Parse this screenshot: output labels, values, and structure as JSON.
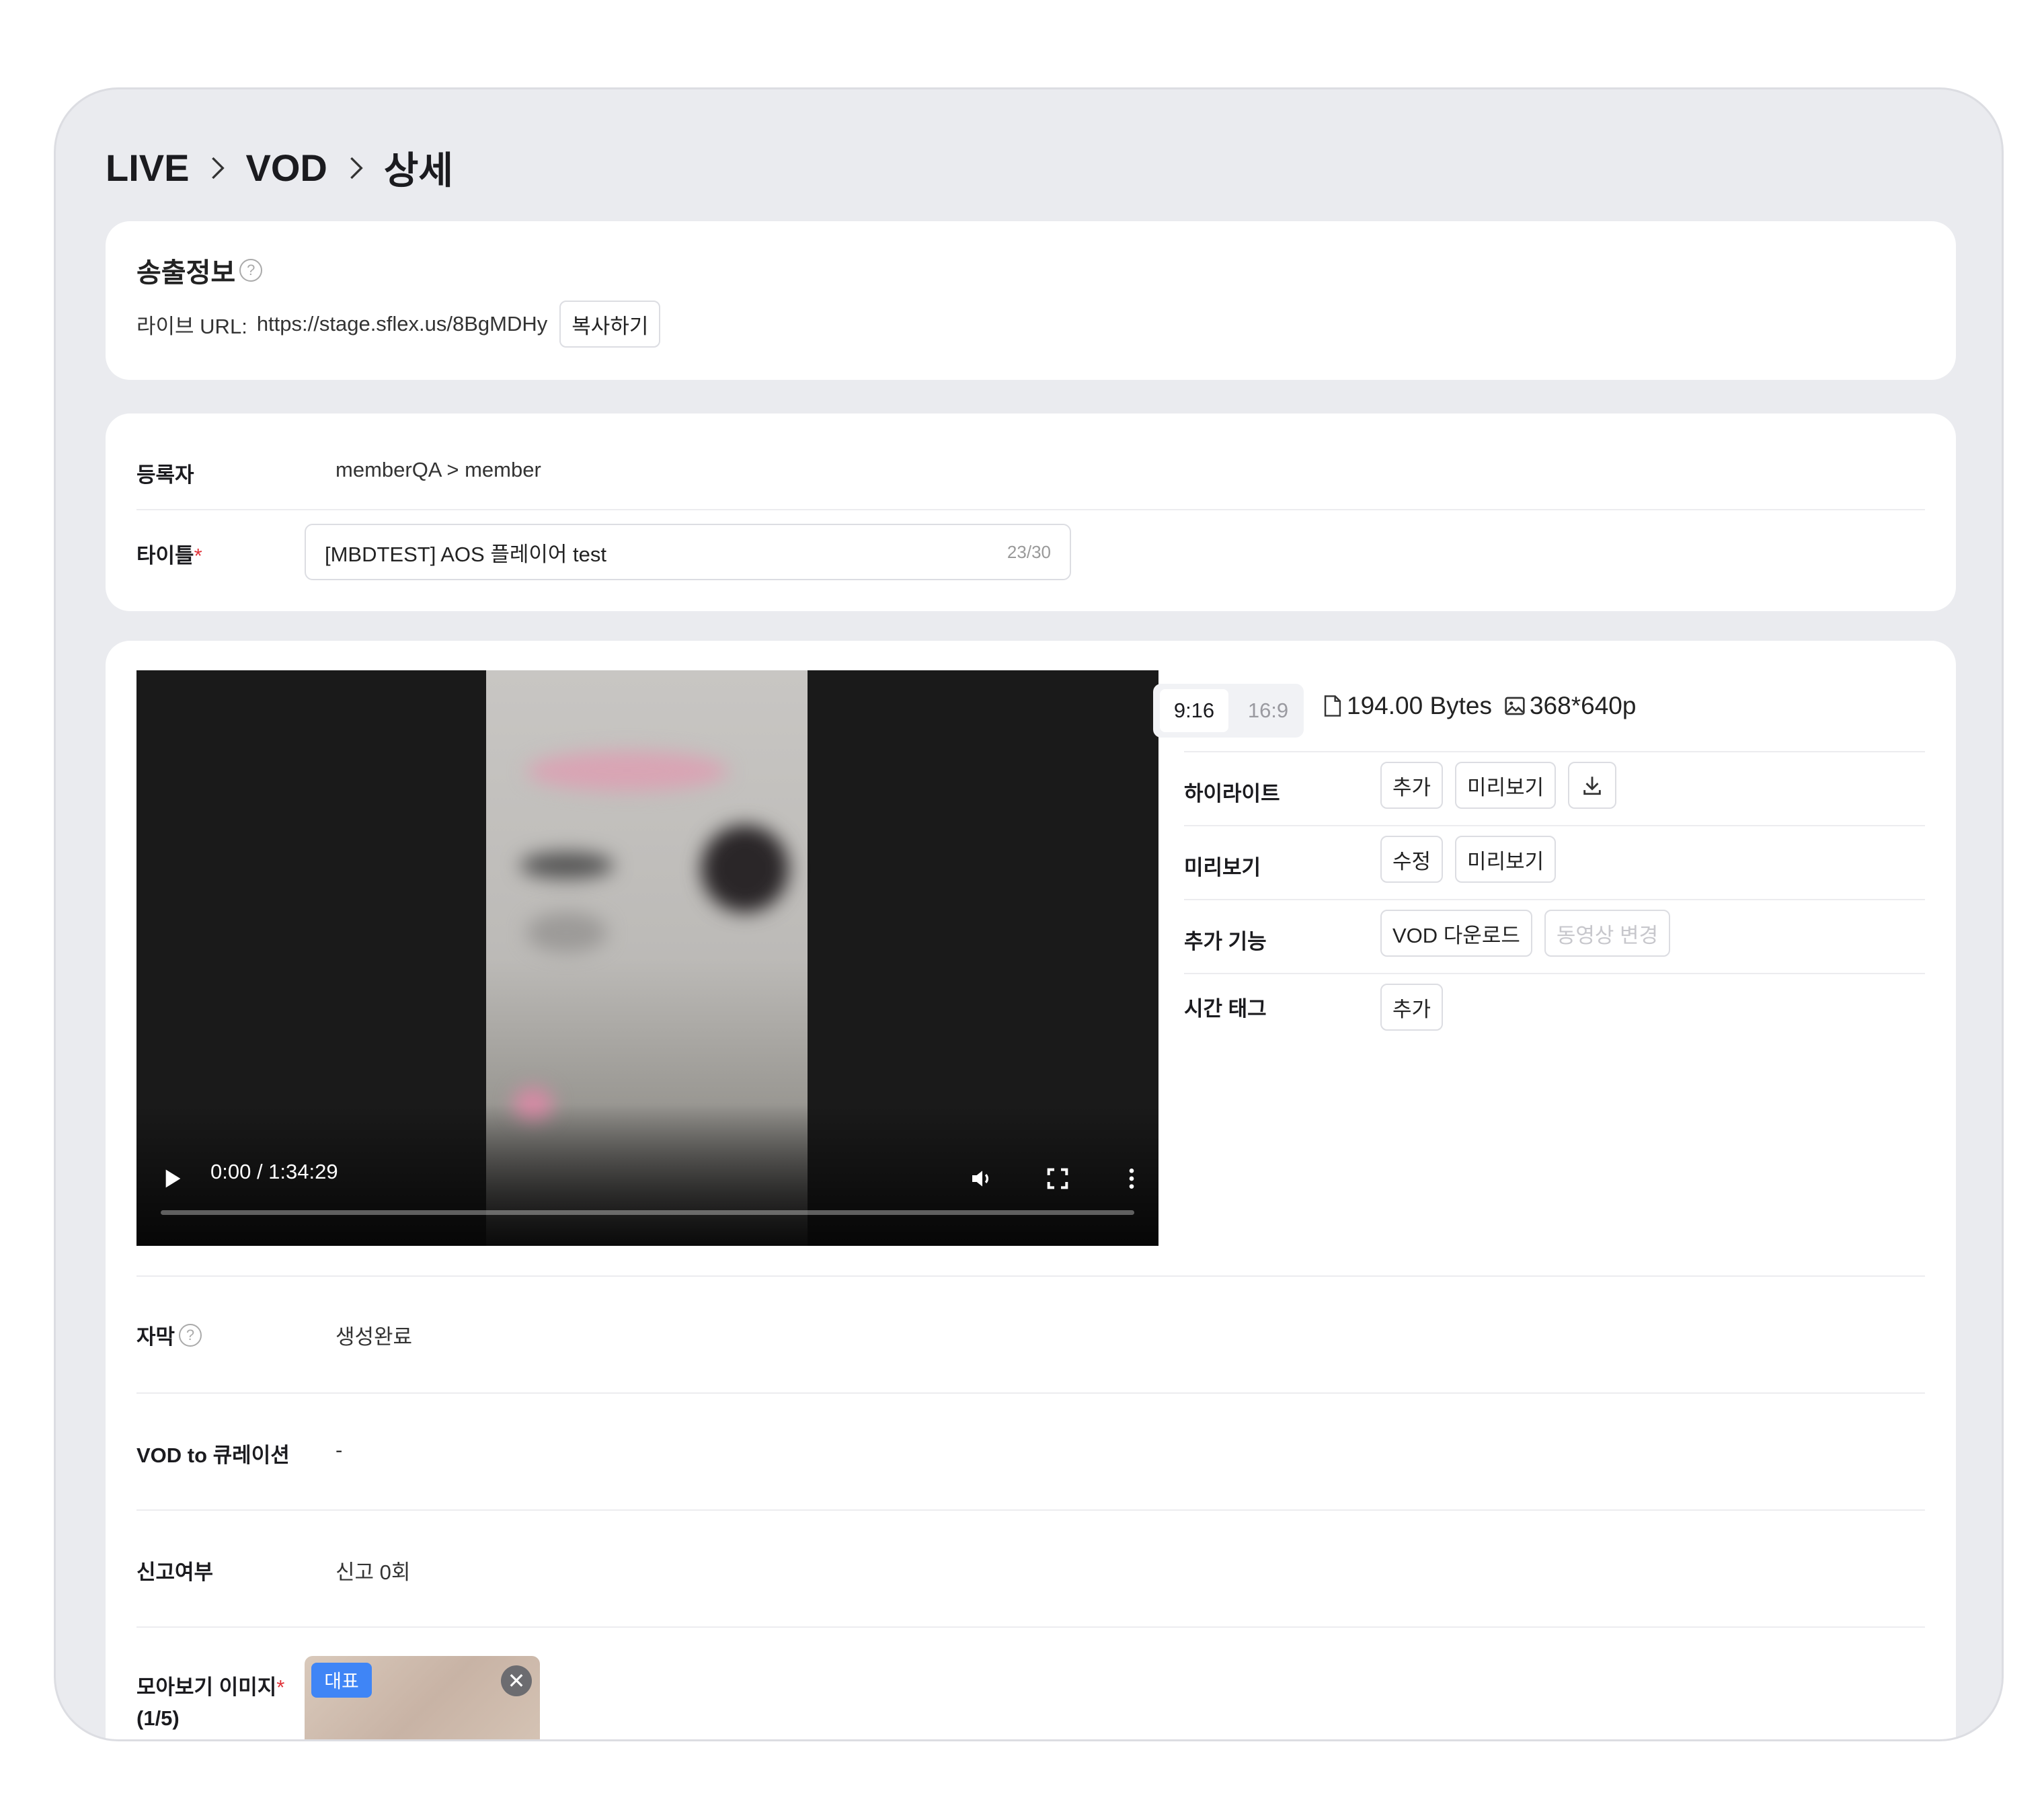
{
  "breadcrumb": [
    "LIVE",
    "VOD",
    "상세"
  ],
  "broadcast": {
    "title": "송출정보",
    "help_icon": "?",
    "url_label": "라이브 URL:",
    "url_value": "https://stage.sflex.us/8BgMDHy",
    "copy_label": "복사하기"
  },
  "registrant": {
    "label": "등록자",
    "value": "memberQA > member"
  },
  "title_field": {
    "label": "타이틀",
    "required_mark": "*",
    "value": "[MBDTEST] AOS 플레이어 test",
    "counter": "23/30"
  },
  "video": {
    "time": "0:00 / 1:34:29",
    "progress": 0
  },
  "ratio": {
    "options": [
      "9:16",
      "16:9"
    ],
    "selected": "9:16"
  },
  "file_info": {
    "size": "194.00 Bytes",
    "resolution": "368*640p"
  },
  "panel": {
    "highlight": {
      "label": "하이라이트",
      "add": "추가",
      "preview": "미리보기"
    },
    "preview": {
      "label": "미리보기",
      "edit": "수정",
      "preview": "미리보기"
    },
    "extra": {
      "label": "추가 기능",
      "vod_download": "VOD 다운로드",
      "change_video": "동영상 변경"
    },
    "timetag": {
      "label": "시간 태그",
      "add": "추가"
    }
  },
  "subtitle": {
    "label": "자막",
    "value": "생성완료"
  },
  "curation": {
    "label": "VOD to 큐레이션",
    "value": "-"
  },
  "report": {
    "label": "신고여부",
    "value": "신고 0회"
  },
  "gallery": {
    "label": "모아보기 이미지",
    "required_mark": "*",
    "count": "(1/5)",
    "badge": "대표",
    "remove": "✕"
  },
  "colors": {
    "accent": "#3f85f6",
    "required": "#e0343a",
    "frame_bg": "#eaebef"
  }
}
